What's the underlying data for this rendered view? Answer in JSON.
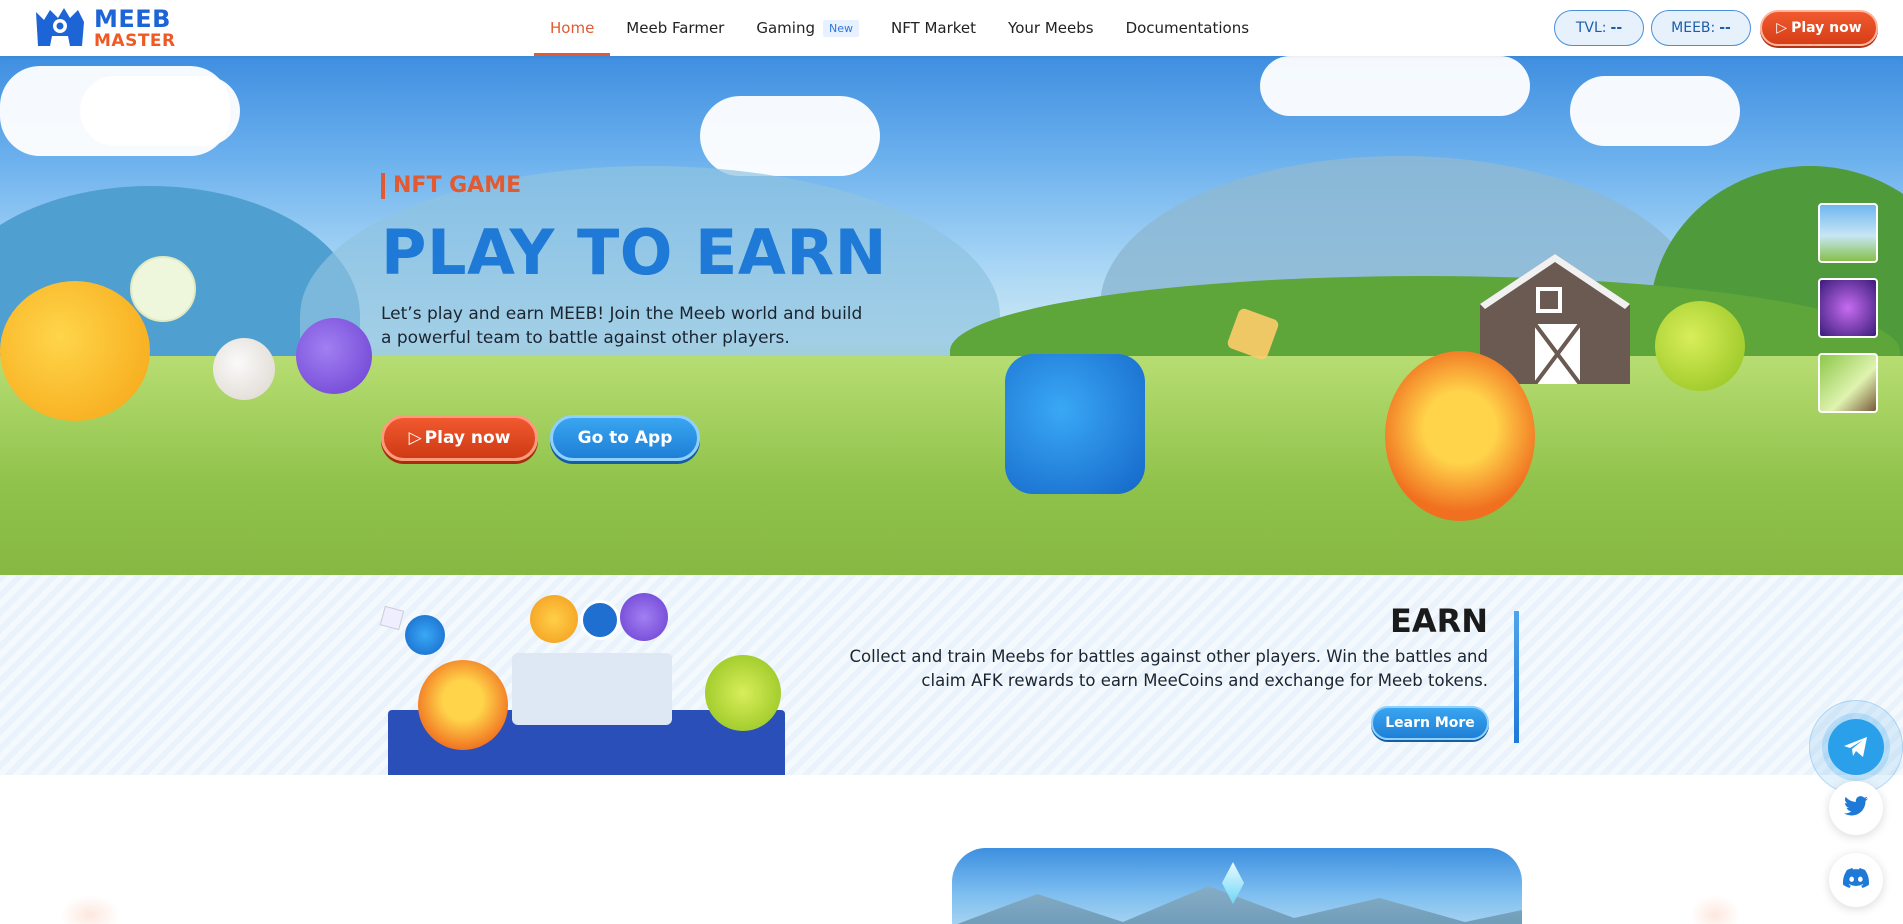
{
  "brand": {
    "line1": "MEEB",
    "line2": "MASTER"
  },
  "nav": {
    "items": [
      {
        "label": "Home",
        "active": true
      },
      {
        "label": "Meeb Farmer"
      },
      {
        "label": "Gaming",
        "badge": "New"
      },
      {
        "label": "NFT Market"
      },
      {
        "label": "Your Meebs"
      },
      {
        "label": "Documentations"
      }
    ]
  },
  "header": {
    "tvl_label": "TVL:",
    "tvl_value": "--",
    "meeb_label": "MEEB:",
    "meeb_value": "--",
    "play_label": "Play now"
  },
  "hero": {
    "eyebrow": "NFT GAME",
    "title": "PLAY TO EARN",
    "description": "Let’s play and earn MEEB! Join the Meeb world and build a powerful team to battle against other players.",
    "play_button": "Play now",
    "app_button": "Go to App"
  },
  "earn": {
    "title": "EARN",
    "description": "Collect and train Meebs for battles against other players. Win the battles and claim AFK rewards to earn MeeCoins and exchange for Meeb tokens.",
    "button": "Learn More"
  },
  "socials": [
    "telegram-icon",
    "twitter-icon",
    "discord-icon"
  ],
  "colors": {
    "accent": "#e25a31",
    "primary": "#1f79d6"
  }
}
